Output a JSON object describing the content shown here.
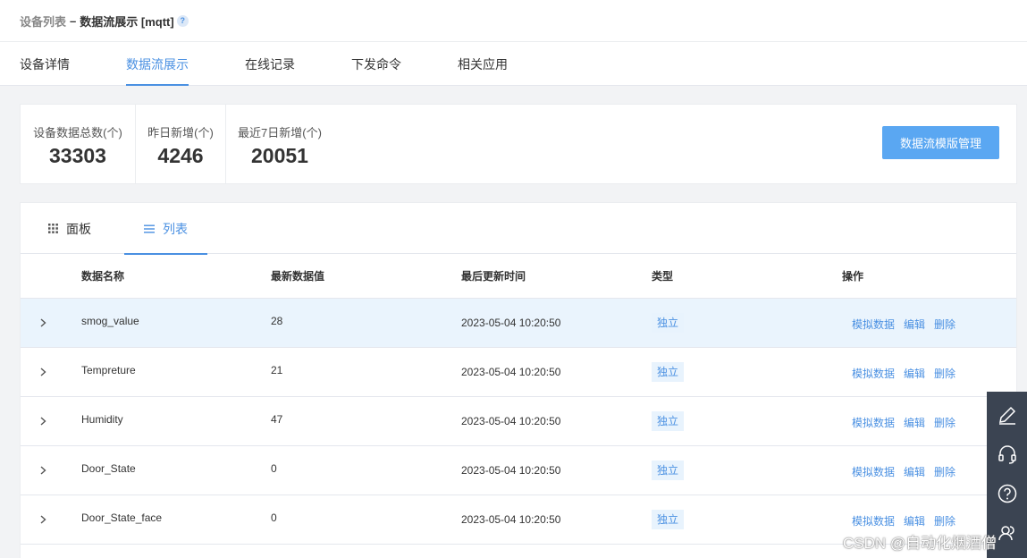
{
  "breadcrumb": {
    "parent": "设备列表",
    "separator": "–",
    "current": "数据流展示 [mqtt]",
    "help": "?"
  },
  "main_tabs": [
    {
      "label": "设备详情",
      "active": false
    },
    {
      "label": "数据流展示",
      "active": true
    },
    {
      "label": "在线记录",
      "active": false
    },
    {
      "label": "下发命令",
      "active": false
    },
    {
      "label": "相关应用",
      "active": false
    }
  ],
  "stats": [
    {
      "label": "设备数据总数(个)",
      "value": "33303"
    },
    {
      "label": "昨日新增(个)",
      "value": "4246"
    },
    {
      "label": "最近7日新增(个)",
      "value": "20051"
    }
  ],
  "template_button": "数据流模版管理",
  "view_tabs": [
    {
      "label": "面板",
      "icon": "grid-icon",
      "active": false
    },
    {
      "label": "列表",
      "icon": "list-icon",
      "active": true
    }
  ],
  "table": {
    "headers": [
      "数据名称",
      "最新数据值",
      "最后更新时间",
      "类型",
      "操作"
    ],
    "rows": [
      {
        "name": "smog_value",
        "value": "28",
        "time": "2023-05-04 10:20:50",
        "type": "独立"
      },
      {
        "name": "Tempreture",
        "value": "21",
        "time": "2023-05-04 10:20:50",
        "type": "独立"
      },
      {
        "name": "Humidity",
        "value": "47",
        "time": "2023-05-04 10:20:50",
        "type": "独立"
      },
      {
        "name": "Door_State",
        "value": "0",
        "time": "2023-05-04 10:20:50",
        "type": "独立"
      },
      {
        "name": "Door_State_face",
        "value": "0",
        "time": "2023-05-04 10:20:50",
        "type": "独立"
      }
    ],
    "actions": [
      "模拟数据",
      "编辑",
      "删除"
    ]
  },
  "side_toolbar": [
    "edit-icon",
    "headset-icon",
    "help-icon",
    "users-icon"
  ],
  "watermark": "CSDN @自动化烟酒僧",
  "colors": {
    "accent": "#4a90e2",
    "button": "#5aa7f2",
    "row_highlight": "#eaf4fd",
    "toolbar": "#3b4452"
  }
}
